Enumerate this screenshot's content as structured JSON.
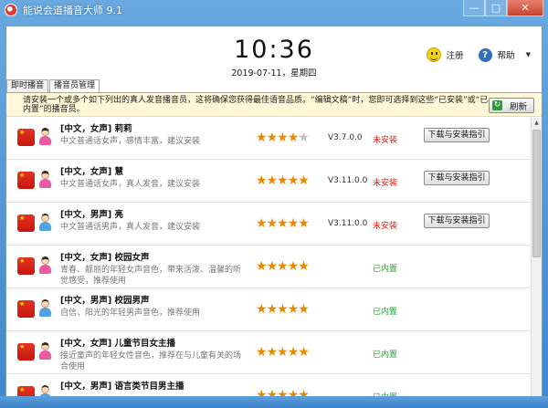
{
  "window": {
    "title": "能说会道播音大师 9.1",
    "controls": {
      "minimize": "—",
      "maximize": "□",
      "close": "✕"
    }
  },
  "header": {
    "time": "10:36",
    "date": "2019-07-11，星期四",
    "register_label": "注册",
    "help_label": "帮助"
  },
  "tabs": [
    {
      "label": "即时播音",
      "active": false
    },
    {
      "label": "播音员管理",
      "active": true
    }
  ],
  "notice": {
    "text": "请安装一个或多个如下列出的真人发音播音员，这将确保您获得最佳语音品质。“编辑文稿”时，您即可选择到这些“已安装”或“已内置”的播音员。",
    "refresh_label": "刷新"
  },
  "voices": [
    {
      "title": "[中文，女声] 莉莉",
      "desc": "中文普通话女声，感情丰富，建议安装",
      "gender": "female",
      "rating": 4,
      "version": "V3.7.0.0",
      "status": "未安装",
      "installed": false,
      "action": "下载与安装指引"
    },
    {
      "title": "[中文，女声] 慧",
      "desc": "中文普通话女声，真人发音，建议安装",
      "gender": "female",
      "rating": 5,
      "version": "V3.11.0.0",
      "status": "未安装",
      "installed": false,
      "action": "下载与安装指引"
    },
    {
      "title": "[中文，男声] 亮",
      "desc": "中文普通话男声，真人发音，建议安装",
      "gender": "male",
      "rating": 5,
      "version": "V3.11.0.0",
      "status": "未安装",
      "installed": false,
      "action": "下载与安装指引"
    },
    {
      "title": "[中文，女声] 校园女声",
      "desc": "青春、靓丽的年轻女声音色，带来活泼、温馨的听觉感受，推荐使用",
      "gender": "female",
      "rating": 5,
      "version": "",
      "status": "已内置",
      "installed": true,
      "action": ""
    },
    {
      "title": "[中文，男声] 校园男声",
      "desc": "自信、阳光的年轻男声音色，推荐使用",
      "gender": "male",
      "rating": 5,
      "version": "",
      "status": "已内置",
      "installed": true,
      "action": ""
    },
    {
      "title": "[中文，女声] 儿童节目女主播",
      "desc": "接近童声的年轻女性音色，推荐在与儿童有关的场合使用",
      "gender": "female",
      "rating": 5,
      "version": "",
      "status": "已内置",
      "installed": true,
      "action": ""
    },
    {
      "title": "[中文，男声] 语言类节目男主播",
      "desc": "",
      "gender": "male",
      "rating": 5,
      "version": "",
      "status": "已内置",
      "installed": true,
      "action": ""
    }
  ]
}
